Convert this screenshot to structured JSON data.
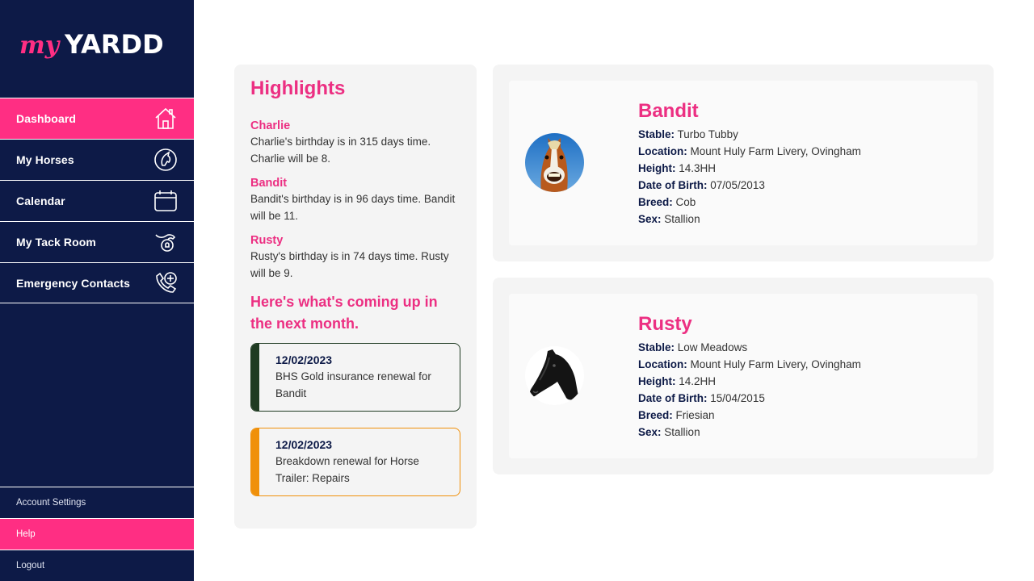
{
  "brand": {
    "logo_text_my": "my",
    "logo_text_yardd": "YARDD"
  },
  "nav": [
    {
      "label": "Dashboard",
      "icon": "home-icon",
      "active": true
    },
    {
      "label": "My Horses",
      "icon": "horse-head-icon",
      "active": false
    },
    {
      "label": "Calendar",
      "icon": "calendar-icon",
      "active": false
    },
    {
      "label": "My Tack Room",
      "icon": "saddle-icon",
      "active": false
    },
    {
      "label": "Emergency Contacts",
      "icon": "phone-medical-icon",
      "active": false
    }
  ],
  "bottom_nav": [
    {
      "label": "Account Settings",
      "active": false
    },
    {
      "label": "Help",
      "active": true
    },
    {
      "label": "Logout",
      "active": false
    }
  ],
  "highlights": {
    "title": "Highlights",
    "items": [
      {
        "name": "Charlie",
        "text": "Charlie's birthday is in 315 days time. Charlie will be 8."
      },
      {
        "name": "Bandit",
        "text": "Bandit's birthday is in 96 days time. Bandit will be 11."
      },
      {
        "name": "Rusty",
        "text": "Rusty's birthday is in 74 days time. Rusty will be 9."
      }
    ],
    "upcoming_title": "Here's what's coming up in the next month.",
    "events": [
      {
        "date": "12/02/2023",
        "description": "BHS Gold insurance renewal for Bandit",
        "color": "#1f3b22"
      },
      {
        "date": "12/02/2023",
        "description": "Breakdown renewal for Horse Trailer: Repairs",
        "color": "#f0900a"
      }
    ]
  },
  "labels": {
    "stable": "Stable:",
    "location": "Location:",
    "height": "Height:",
    "dob": "Date of Birth:",
    "breed": "Breed:",
    "sex": "Sex:"
  },
  "horses": [
    {
      "name": "Bandit",
      "stable": "Turbo Tubby",
      "location": "Mount Huly Farm Livery, Ovingham",
      "height": "14.3HH",
      "dob": "07/05/2013",
      "breed": "Cob",
      "sex": "Stallion"
    },
    {
      "name": "Rusty",
      "stable": "Low Meadows",
      "location": "Mount Huly Farm Livery, Ovingham",
      "height": "14.2HH",
      "dob": "15/04/2015",
      "breed": "Friesian",
      "sex": "Stallion"
    }
  ],
  "colors": {
    "sidebar": "#0d1a47",
    "accent": "#ff2e83",
    "heading": "#ec2f82"
  }
}
